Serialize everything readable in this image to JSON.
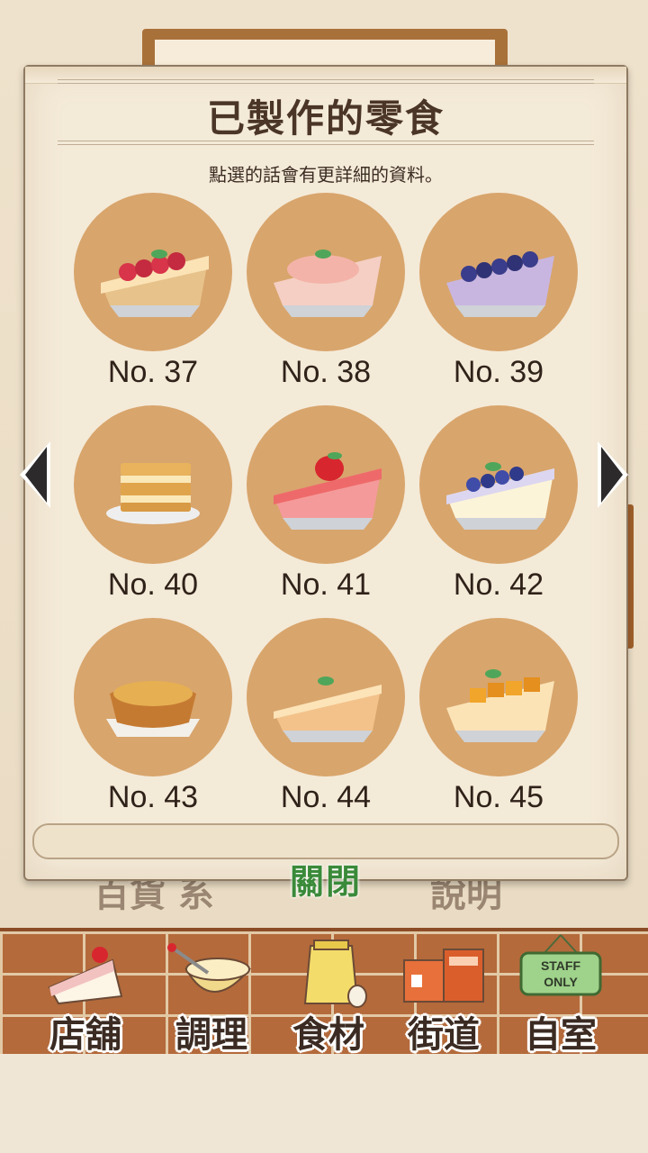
{
  "panel": {
    "title": "已製作的零食",
    "subtitle": "點選的話會有更詳細的資料。",
    "close_label": "關閉"
  },
  "items": [
    {
      "label": "No. 37",
      "dessert": "raspberry-tart-icon",
      "color": "#d8344a"
    },
    {
      "label": "No. 38",
      "dessert": "peach-tart-icon",
      "color": "#f4b3a8"
    },
    {
      "label": "No. 39",
      "dessert": "blueberry-tart-icon",
      "color": "#3a3d8c"
    },
    {
      "label": "No. 40",
      "dessert": "mille-feuille-icon",
      "color": "#e8b35c"
    },
    {
      "label": "No. 41",
      "dessert": "strawberry-cake-icon",
      "color": "#ee6a6a"
    },
    {
      "label": "No. 42",
      "dessert": "blueberry-cheesecake-icon",
      "color": "#3f4ca8"
    },
    {
      "label": "No. 43",
      "dessert": "egg-tart-icon",
      "color": "#d79545"
    },
    {
      "label": "No. 44",
      "dessert": "cheesecake-slice-icon",
      "color": "#f3c28a"
    },
    {
      "label": "No. 45",
      "dessert": "mango-tart-icon",
      "color": "#f1a52a"
    }
  ],
  "background": {
    "left_text": "百貨 系",
    "right_text": "說明"
  },
  "bottom_nav": [
    {
      "label": "店舖",
      "icon": "cake-slice-icon"
    },
    {
      "label": "調理",
      "icon": "mixing-bowl-icon"
    },
    {
      "label": "食材",
      "icon": "flour-bag-icon"
    },
    {
      "label": "街道",
      "icon": "street-shop-icon"
    },
    {
      "label": "自室",
      "icon": "staff-only-sign-icon",
      "sign_text": "STAFF ONLY"
    }
  ],
  "colors": {
    "plate": "#d8a56c",
    "close_text": "#3a8a3a",
    "brick": "#b46a3b"
  }
}
